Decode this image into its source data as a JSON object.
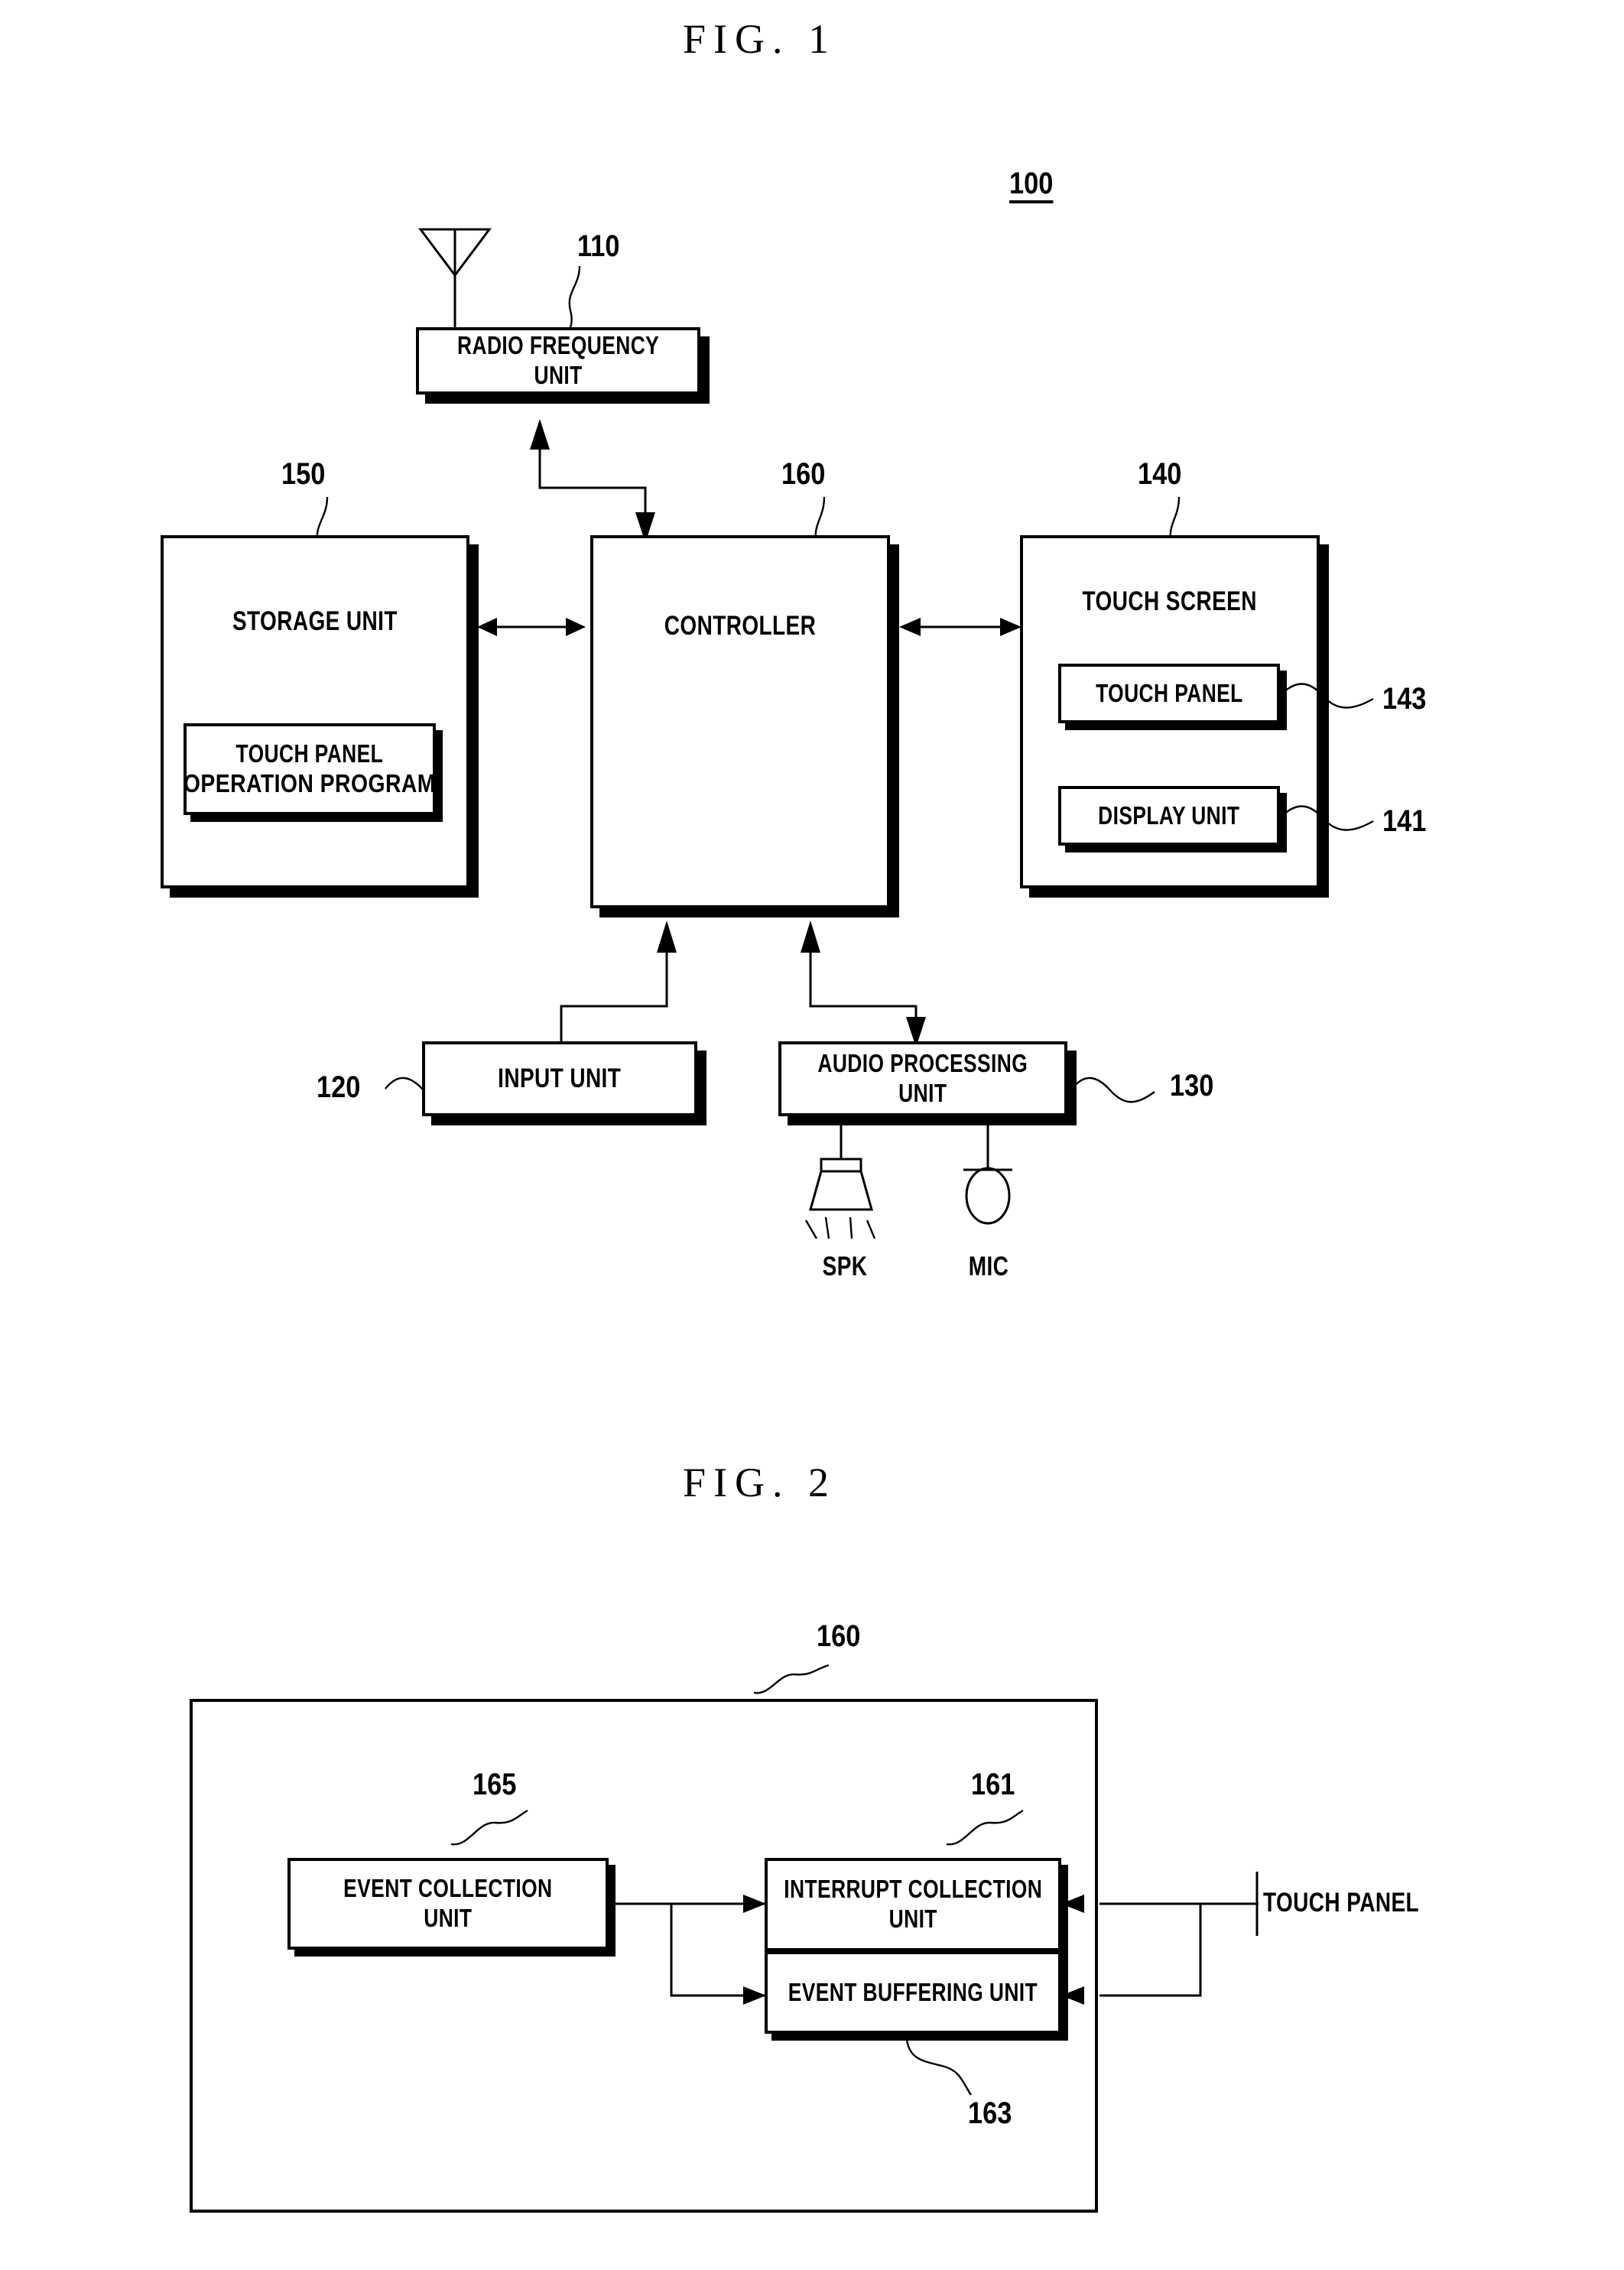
{
  "figures": [
    {
      "title": "FIG. 1",
      "system_ref": "100",
      "blocks": [
        {
          "ref": "110",
          "label_line1": "RADIO FREQUENCY",
          "label_line2": "UNIT"
        },
        {
          "ref": "150",
          "label_line1": "STORAGE UNIT",
          "label_line2": ""
        },
        {
          "ref": "",
          "label_line1": "TOUCH PANEL",
          "label_line2": "OPERATION PROGRAM"
        },
        {
          "ref": "160",
          "label_line1": "CONTROLLER",
          "label_line2": ""
        },
        {
          "ref": "140",
          "label_line1": "TOUCH SCREEN",
          "label_line2": ""
        },
        {
          "ref": "143",
          "label_line1": "TOUCH PANEL",
          "label_line2": ""
        },
        {
          "ref": "141",
          "label_line1": "DISPLAY UNIT",
          "label_line2": ""
        },
        {
          "ref": "120",
          "label_line1": "INPUT UNIT",
          "label_line2": ""
        },
        {
          "ref": "130",
          "label_line1": "AUDIO PROCESSING",
          "label_line2": "UNIT"
        }
      ],
      "transducers": [
        {
          "icon": "speaker-icon",
          "label": "SPK"
        },
        {
          "icon": "microphone-icon",
          "label": "MIC"
        }
      ],
      "antenna_icon": "antenna-icon"
    },
    {
      "title": "FIG. 2",
      "system_ref": "160",
      "blocks": [
        {
          "ref": "165",
          "label_line1": "EVENT COLLECTION",
          "label_line2": "UNIT"
        },
        {
          "ref": "161",
          "label_line1": "INTERRUPT COLLECTION",
          "label_line2": "UNIT"
        },
        {
          "ref": "163",
          "label_line1": "EVENT BUFFERING UNIT",
          "label_line2": ""
        }
      ],
      "external_label": "TOUCH PANEL"
    }
  ],
  "fig1": {
    "title": "FIG. 1",
    "system_ref": "100",
    "rf_unit": {
      "ref": "110",
      "l1": "RADIO FREQUENCY",
      "l2": "UNIT"
    },
    "storage_unit": {
      "ref": "150",
      "l1": "STORAGE UNIT"
    },
    "program": {
      "l1": "TOUCH PANEL",
      "l2": "OPERATION PROGRAM"
    },
    "controller": {
      "ref": "160",
      "l1": "CONTROLLER"
    },
    "touch_screen": {
      "ref": "140",
      "l1": "TOUCH SCREEN"
    },
    "touch_panel": {
      "ref": "143",
      "l1": "TOUCH PANEL"
    },
    "display_unit": {
      "ref": "141",
      "l1": "DISPLAY UNIT"
    },
    "input_unit": {
      "ref": "120",
      "l1": "INPUT UNIT"
    },
    "audio_unit": {
      "ref": "130",
      "l1": "AUDIO PROCESSING",
      "l2": "UNIT"
    },
    "spk": "SPK",
    "mic": "MIC"
  },
  "fig2": {
    "title": "FIG. 2",
    "system_ref": "160",
    "event_collection": {
      "ref": "165",
      "l1": "EVENT COLLECTION",
      "l2": "UNIT"
    },
    "interrupt_collection": {
      "ref": "161",
      "l1": "INTERRUPT COLLECTION",
      "l2": "UNIT"
    },
    "event_buffering": {
      "ref": "163",
      "l1": "EVENT BUFFERING UNIT"
    },
    "touch_panel_label": "TOUCH PANEL"
  },
  "colors": {
    "ink": "#000000",
    "paper": "#ffffff"
  }
}
